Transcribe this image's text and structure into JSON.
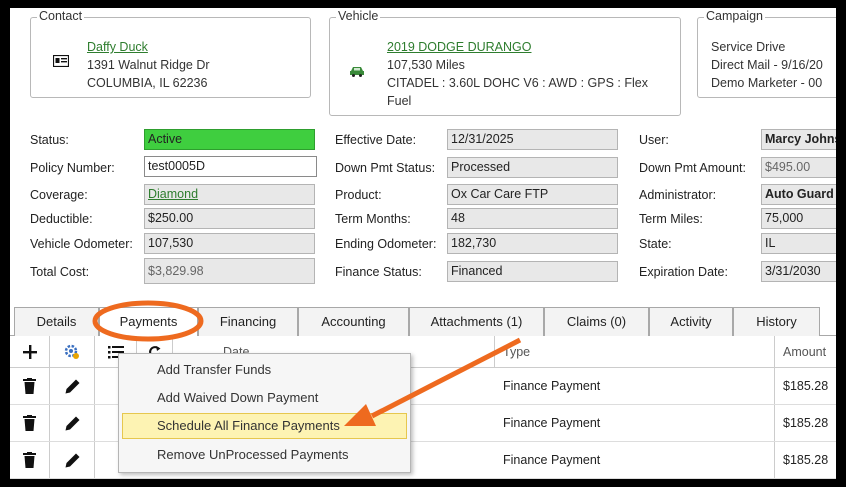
{
  "contact": {
    "legend": "Contact",
    "name": "Daffy Duck",
    "address1": "1391 Walnut Ridge Dr",
    "address2": "COLUMBIA, IL 62236"
  },
  "vehicle": {
    "legend": "Vehicle",
    "title": "2019 DODGE DURANGO",
    "miles": "107,530 Miles",
    "spec1": "CITADEL : 3.60L DOHC V6 : AWD : GPS : Flex",
    "spec2": "Fuel"
  },
  "campaign": {
    "legend": "Campaign",
    "line1": "Service Drive",
    "line2": "Direct Mail - 9/16/20",
    "line3": "Demo Marketer - 00"
  },
  "fields": {
    "status_label": "Status:",
    "status_value": "Active",
    "policy_label": "Policy Number:",
    "policy_value": "test0005D",
    "coverage_label": "Coverage:",
    "coverage_value": "Diamond",
    "deductible_label": "Deductible:",
    "deductible_value": "$250.00",
    "odometer_label": "Vehicle Odometer:",
    "odometer_value": "107,530",
    "total_cost_label": "Total Cost:",
    "total_cost_value": "$3,829.98",
    "effective_label": "Effective Date:",
    "effective_value": "12/31/2025",
    "down_status_label": "Down Pmt Status:",
    "down_status_value": "Processed",
    "product_label": "Product:",
    "product_value": "Ox Car Care FTP",
    "term_months_label": "Term Months:",
    "term_months_value": "48",
    "ending_odo_label": "Ending Odometer:",
    "ending_odo_value": "182,730",
    "finance_status_label": "Finance Status:",
    "finance_status_value": "Financed",
    "user_label": "User:",
    "user_value": "Marcy Johns",
    "down_amount_label": "Down Pmt Amount:",
    "down_amount_value": "$495.00",
    "admin_label": "Administrator:",
    "admin_value": "Auto Guard",
    "term_miles_label": "Term Miles:",
    "term_miles_value": "75,000",
    "state_label": "State:",
    "state_value": "IL",
    "expiration_label": "Expiration Date:",
    "expiration_value": "3/31/2030"
  },
  "tabs": [
    "Details",
    "Payments",
    "Financing",
    "Accounting",
    "Attachments (1)",
    "Claims (0)",
    "Activity",
    "History"
  ],
  "active_tab": "Payments",
  "grid": {
    "toolbar_icons": [
      "plus-icon",
      "gear-icon",
      "list-icon",
      "refresh-icon"
    ],
    "col_date": "Date",
    "col_type": "Type",
    "col_amount": "Amount",
    "rows": [
      {
        "type": "Finance Payment",
        "amount": "$185.28"
      },
      {
        "type": "Finance Payment",
        "amount": "$185.28"
      },
      {
        "type": "Finance Payment",
        "amount": "$185.28"
      }
    ]
  },
  "context_menu": {
    "items": [
      "Add Transfer Funds",
      "Add Waived Down Payment",
      "Schedule All Finance Payments",
      "Remove UnProcessed Payments"
    ],
    "highlighted": "Schedule All Finance Payments"
  },
  "annotation_color": "#ee6a1f",
  "colors": {
    "active_status": "#3fce3f",
    "link": "#2e7d2e",
    "menu_highlight": "#fdf3b3"
  }
}
